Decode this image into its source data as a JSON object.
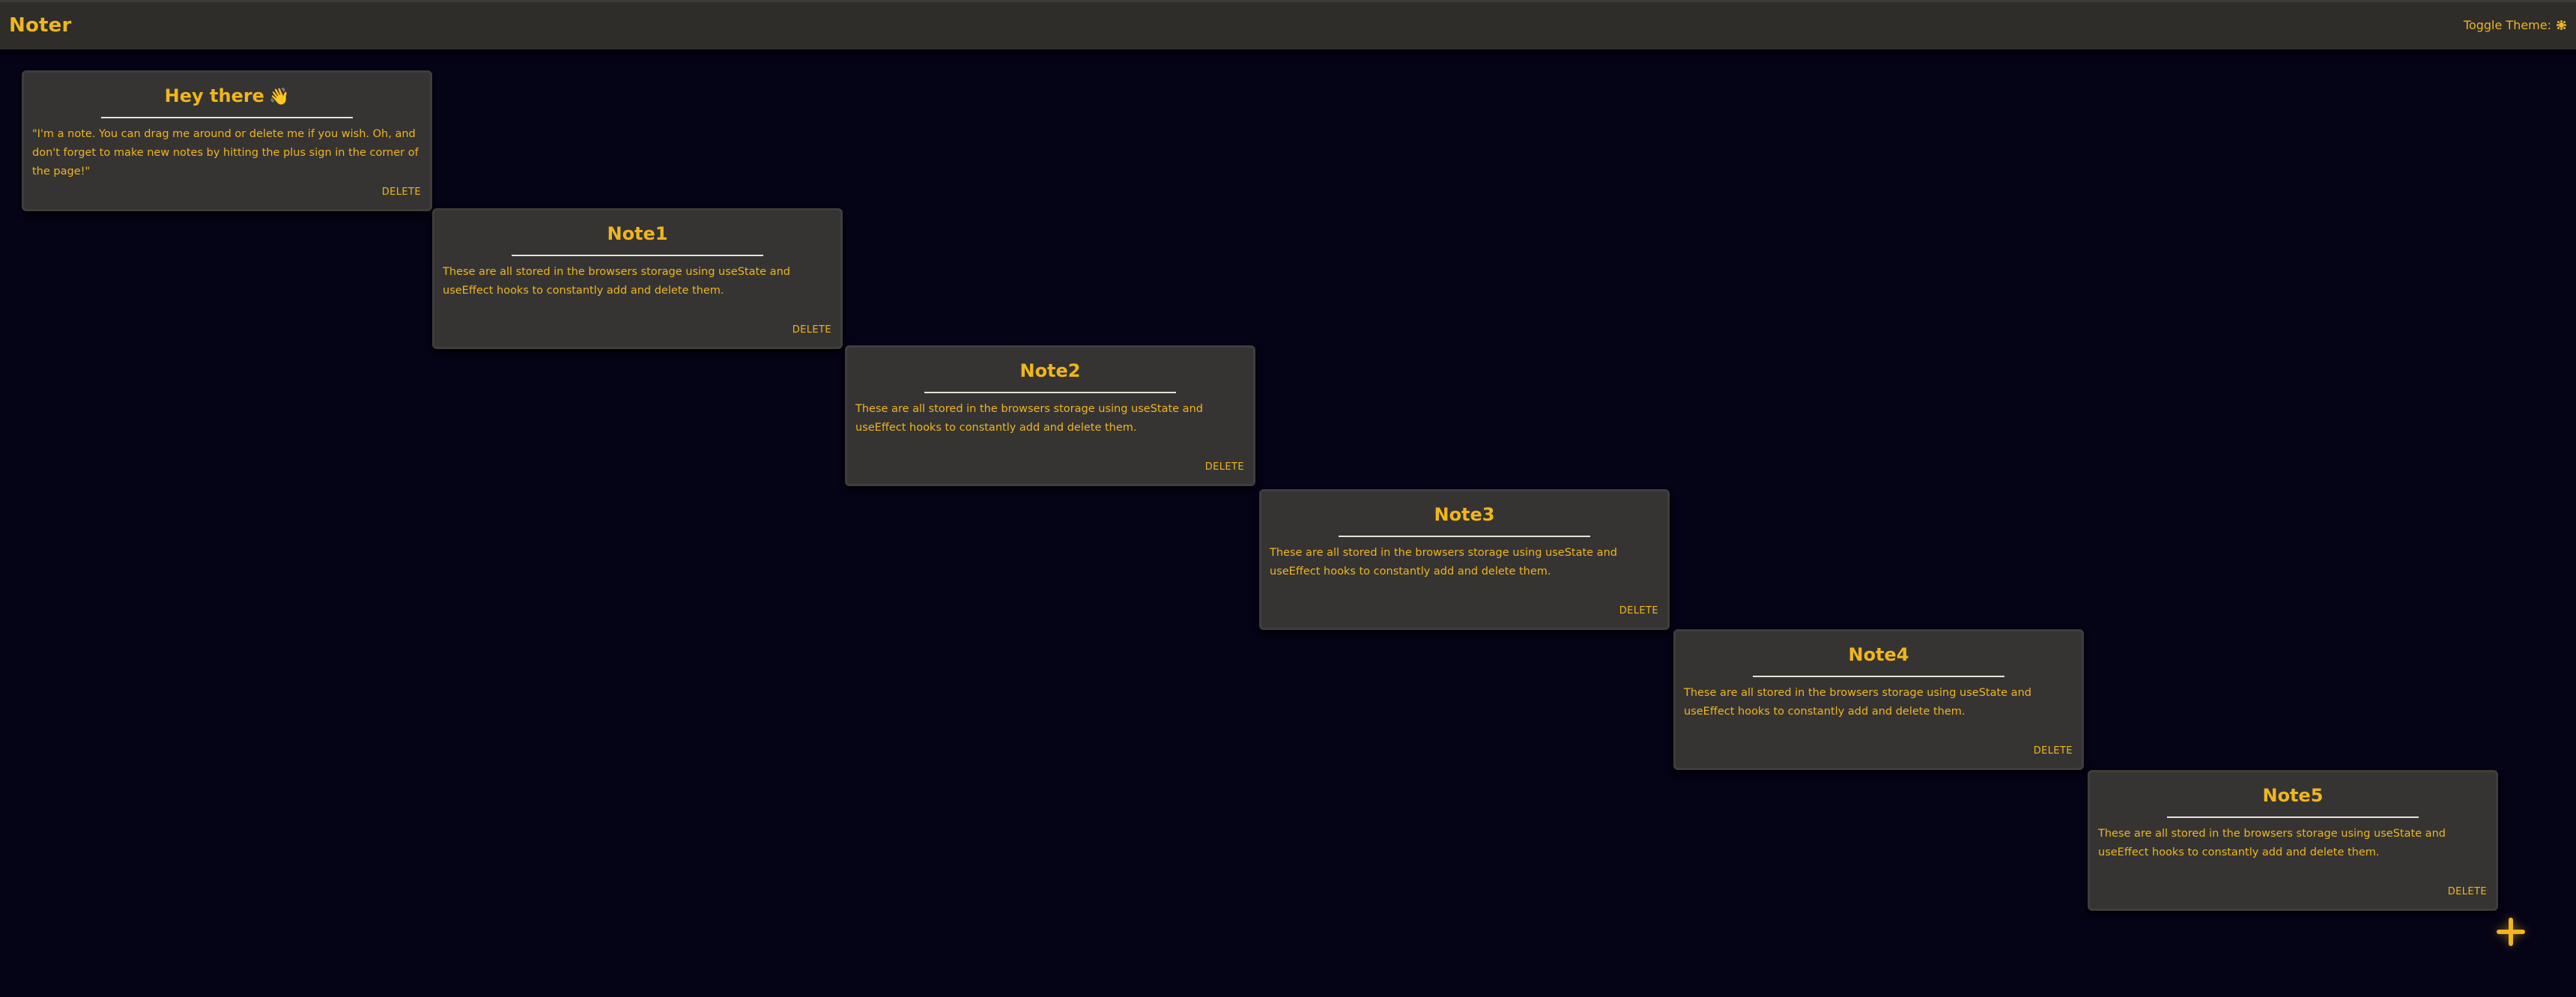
{
  "app": {
    "title": "Noter",
    "theme_toggle_label": "Toggle Theme:",
    "theme_icon": "sun-icon"
  },
  "notes": [
    {
      "title": "Hey there",
      "title_icon": "👋",
      "body": "\"I'm a note. You can drag me around or delete me if you wish. Oh, and don't forget to make new notes by hitting the plus sign in the corner of the page!\"",
      "delete_label": "DELETE"
    },
    {
      "title": "Note1",
      "body": "These are all stored in the browsers storage using useState and useEffect hooks to constantly add and delete them.",
      "delete_label": "DELETE"
    },
    {
      "title": "Note2",
      "body": "These are all stored in the browsers storage using useState and useEffect hooks to constantly add and delete them.",
      "delete_label": "DELETE"
    },
    {
      "title": "Note3",
      "body": "These are all stored in the browsers storage using useState and useEffect hooks to constantly add and delete them.",
      "delete_label": "DELETE"
    },
    {
      "title": "Note4",
      "body": "These are all stored in the browsers storage using useState and useEffect hooks to constantly add and delete them.",
      "delete_label": "DELETE"
    },
    {
      "title": "Note5",
      "body": "These are all stored in the browsers storage using useState and useEffect hooks to constantly add and delete them.",
      "delete_label": "DELETE"
    }
  ],
  "add_button": {
    "icon": "plus-icon"
  },
  "colors": {
    "background": "#050316",
    "accent": "#f0b51f",
    "note_background": "#353432",
    "topbar_background": "#2e2d2a"
  }
}
